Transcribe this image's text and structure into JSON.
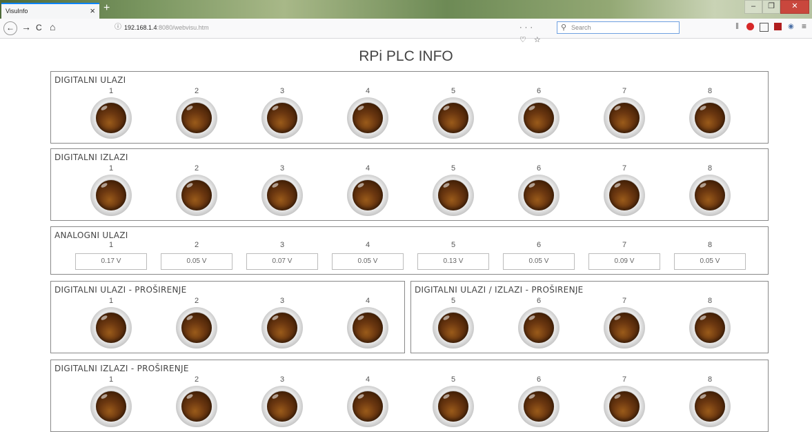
{
  "browser": {
    "tab_title": "VisuInfo",
    "tab_close": "×",
    "new_tab": "+",
    "back_icon": "back-arrow-icon",
    "forward": "→",
    "reload": "C",
    "home": "⌂",
    "url_host": "192.168.1.4",
    "url_rest": ":8080/webvisu.htm",
    "url_actions": "··· ♡ ☆",
    "search_placeholder": "Search",
    "window_minimize": "–",
    "window_restore": "❐",
    "window_close": "✕",
    "accent_color": "#0a84ff"
  },
  "page": {
    "title": "RPi PLC INFO"
  },
  "panels": {
    "di": {
      "title": "DIGITALNI ULAZI",
      "channels": [
        "1",
        "2",
        "3",
        "4",
        "5",
        "6",
        "7",
        "8"
      ]
    },
    "do": {
      "title": "DIGITALNI IZLAZI",
      "channels": [
        "1",
        "2",
        "3",
        "4",
        "5",
        "6",
        "7",
        "8"
      ]
    },
    "ai": {
      "title": "ANALOGNI ULAZI",
      "channels": [
        "1",
        "2",
        "3",
        "4",
        "5",
        "6",
        "7",
        "8"
      ],
      "values": [
        "0.17 V",
        "0.05 V",
        "0.07 V",
        "0.05 V",
        "0.13 V",
        "0.05 V",
        "0.09 V",
        "0.05 V"
      ]
    },
    "di_ext": {
      "title": "DIGITALNI ULAZI - PROŠIRENJE",
      "channels": [
        "1",
        "2",
        "3",
        "4"
      ]
    },
    "dio_ext": {
      "title": "DIGITALNI ULAZI / IZLAZI - PROŠIRENJE",
      "channels": [
        "5",
        "6",
        "7",
        "8"
      ]
    },
    "do_ext": {
      "title": "DIGITALNI IZLAZI - PROŠIRENJE",
      "channels": [
        "1",
        "2",
        "3",
        "4",
        "5",
        "6",
        "7",
        "8"
      ]
    }
  },
  "colors": {
    "led_off": "#5a2c0a",
    "panel_border": "#888888"
  }
}
